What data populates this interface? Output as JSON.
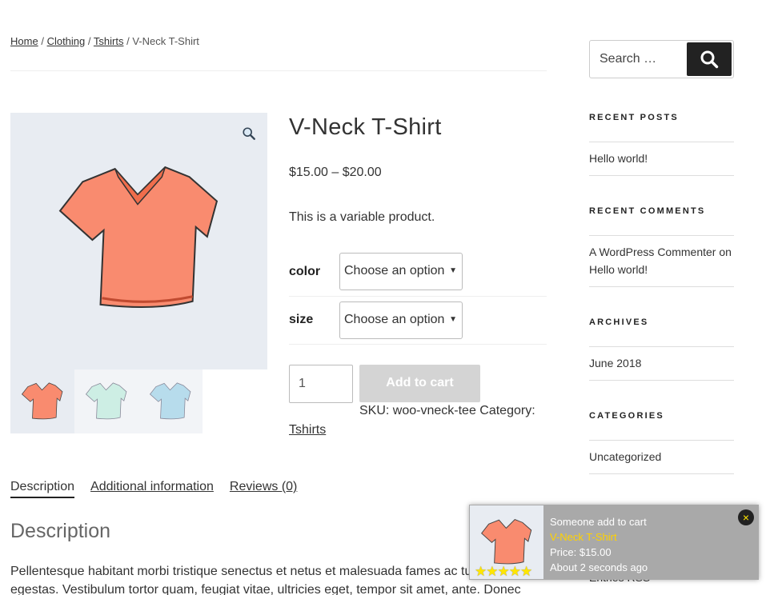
{
  "breadcrumb": {
    "items": [
      "Home",
      "Clothing",
      "Tshirts"
    ],
    "current": "V-Neck T-Shirt",
    "separator": "/"
  },
  "product": {
    "title": "V-Neck T-Shirt",
    "price": "$15.00 – $20.00",
    "short_description": "This is a variable product.",
    "variations": [
      {
        "label": "color",
        "selected": "Choose an option"
      },
      {
        "label": "size",
        "selected": "Choose an option"
      }
    ],
    "quantity": "1",
    "add_to_cart_label": "Add to cart",
    "sku_text": "SKU: woo-vneck-tee Category:",
    "category_link": "Tshirts",
    "image_colors": {
      "main": "#f98b6f",
      "thumb_2": "#cdeee4",
      "thumb_3": "#b7dcec"
    }
  },
  "tabs": [
    {
      "label": "Description",
      "active": true
    },
    {
      "label": "Additional information",
      "active": false
    },
    {
      "label": "Reviews (0)",
      "active": false
    }
  ],
  "description": {
    "heading": "Description",
    "lines": [
      "Pellentesque habitant morbi tristique senectus et netus et malesuada fames ac turpis",
      "egestas. Vestibulum tortor quam, feugiat vitae, ultricies eget, tempor sit amet, ante. Donec"
    ]
  },
  "sidebar": {
    "search": {
      "placeholder": "Search …"
    },
    "widgets": [
      {
        "title": "RECENT POSTS",
        "items": [
          "Hello world!"
        ]
      },
      {
        "title": "RECENT COMMENTS",
        "items": [
          "A WordPress Commenter on Hello world!"
        ]
      },
      {
        "title": "ARCHIVES",
        "items": [
          "June 2018"
        ]
      },
      {
        "title": "CATEGORIES",
        "items": [
          "Uncategorized"
        ]
      }
    ],
    "partial_text": "Entries RSS"
  },
  "popup": {
    "headline": "Someone add to cart",
    "product": "V-Neck T-Shirt",
    "price": "Price: $15.00",
    "time": "About 2 seconds ago",
    "stars": "★★★★★",
    "close": "×"
  }
}
